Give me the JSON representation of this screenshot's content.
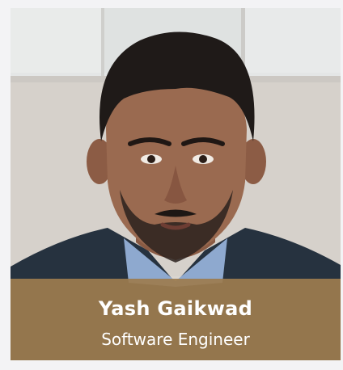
{
  "profile": {
    "name": "Yash Gaikwad",
    "role": "Software Engineer",
    "photo_icon": "portrait-photo",
    "caption_color": "#9d7c4e"
  }
}
